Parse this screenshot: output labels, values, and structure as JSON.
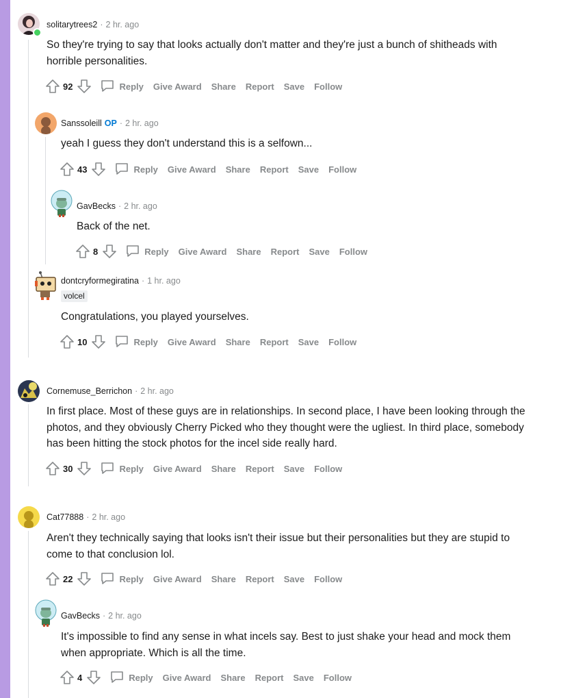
{
  "colors": {
    "accent_stripe": "#b89be3",
    "op_badge": "#0079d3",
    "online": "#46d160",
    "meta_gray": "#878a8c"
  },
  "action_labels": {
    "reply": "Reply",
    "give_award": "Give Award",
    "share": "Share",
    "report": "Report",
    "save": "Save",
    "follow": "Follow"
  },
  "comments": [
    {
      "author": "solitarytrees2",
      "time": "2 hr. ago",
      "body": "So they're trying to say that looks actually don't matter and they're just a bunch of shitheads with horrible personalities.",
      "score": "92"
    },
    {
      "author": "Sanssoleill",
      "op_label": "OP",
      "time": "2 hr. ago",
      "body": "yeah I guess they don't understand this is a selfown...",
      "score": "43"
    },
    {
      "author": "GavBecks",
      "time": "2 hr. ago",
      "body": "Back of the net.",
      "score": "8"
    },
    {
      "author": "dontcryformegiratina",
      "time": "1 hr. ago",
      "flair": "volcel",
      "body": "Congratulations, you played yourselves.",
      "score": "10"
    },
    {
      "author": "Cornemuse_Berrichon",
      "time": "2 hr. ago",
      "body": "In first place. Most of these guys are in relationships. In second place, I have been looking through the photos, and they obviously Cherry Picked who they thought were the ugliest. In third place, somebody has been hitting the stock photos for the incel side really hard.",
      "score": "30"
    },
    {
      "author": "Cat77888",
      "time": "2 hr. ago",
      "body": "Aren't they technically saying that looks isn't their issue but their personalities but they are stupid to come to that conclusion lol.",
      "score": "22"
    },
    {
      "author": "GavBecks",
      "time": "2 hr. ago",
      "body": "It's impossible to find any sense in what incels say. Best to just shake your head and mock them when appropriate. Which is all the time.",
      "score": "4"
    }
  ]
}
